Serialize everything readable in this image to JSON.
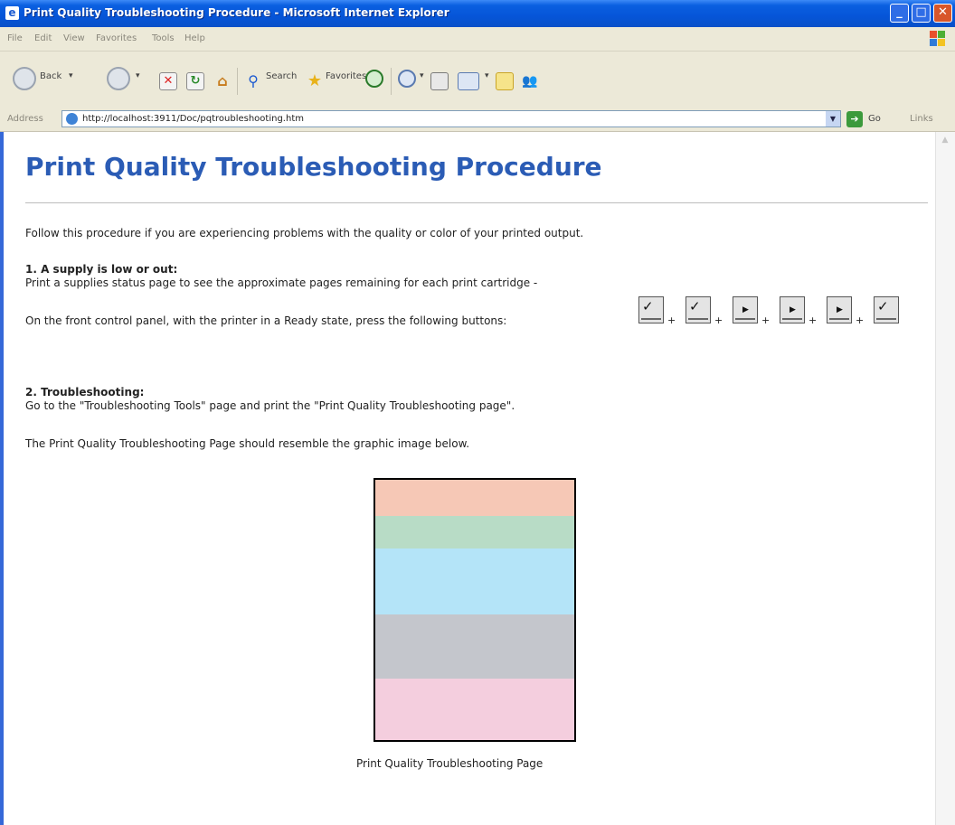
{
  "window": {
    "title": "Print Quality Troubleshooting Procedure - Microsoft Internet Explorer",
    "controls": [
      "_",
      "□",
      "✕"
    ]
  },
  "menu": [
    "File",
    "Edit",
    "View",
    "Favorites",
    "Tools",
    "Help"
  ],
  "toolbar": {
    "back_label": "Back",
    "search_label": "Search",
    "favorites_label": "Favorites",
    "icons": [
      "back-icon",
      "forward-icon",
      "stop-icon",
      "refresh-icon",
      "home-icon",
      "search-icon",
      "favorites-icon",
      "history-icon",
      "mail-icon",
      "print-icon",
      "edit-icon",
      "discuss-icon",
      "messenger-icon"
    ]
  },
  "address": {
    "label": "Address",
    "url": "http://localhost:3911/Doc/pqtroubleshooting.htm",
    "go_label": "Go",
    "links_label": "Links"
  },
  "page": {
    "title": "Print Quality Troubleshooting Procedure",
    "intro": "Follow this procedure if you are experiencing problems with the quality or color of your printed output.",
    "section1": {
      "heading": "1. A supply is low or out:",
      "line1": "Print a supplies status page to see the approximate pages remaining for each print cartridge -",
      "line2": "On the front control panel, with the printer in a Ready state, press the following buttons:",
      "buttons": [
        "check",
        "check",
        "play",
        "play",
        "play",
        "check"
      ],
      "plus": "+"
    },
    "section2": {
      "heading": "2. Troubleshooting:",
      "line1": "Go to the \"Troubleshooting Tools\" page and print the \"Print Quality Troubleshooting page\".",
      "line2": "The Print Quality Troubleshooting Page should resemble the graphic image below."
    },
    "sample_bands": [
      {
        "color": "#f6c8b6",
        "fraction": 0.14
      },
      {
        "color": "#b8dcc6",
        "fraction": 0.125
      },
      {
        "color": "#b4e4f8",
        "fraction": 0.255
      },
      {
        "color": "#c4c6cc",
        "fraction": 0.245
      },
      {
        "color": "#f4cede",
        "fraction": 0.235
      }
    ],
    "caption": "Print Quality Troubleshooting Page"
  },
  "colors": {
    "title_blue": "#2b5cb5",
    "titlebar_blue": "#0655d8",
    "chrome": "#ece9d8"
  }
}
